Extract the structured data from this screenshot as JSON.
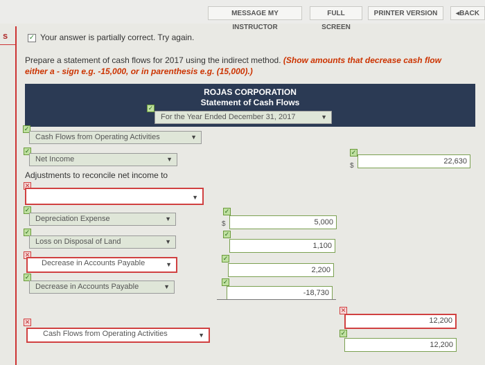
{
  "toolbar": {
    "message_instructor": "MESSAGE MY INSTRUCTOR",
    "full_screen": "FULL SCREEN",
    "printer_version": "PRINTER VERSION",
    "back": "BACK"
  },
  "side_marker": "s",
  "status": {
    "message": "Your answer is partially correct.  Try again."
  },
  "instructions": {
    "line1_plain": "Prepare a statement of cash flows for 2017 using the indirect method.",
    "line1_emphasis": "(Show amounts that decrease cash flow",
    "line2": "either a - sign e.g. -15,000, or in parenthesis e.g. (15,000).)"
  },
  "statement": {
    "company": "ROJAS CORPORATION",
    "title": "Statement of Cash Flows",
    "period": "For the Year Ended December 31, 2017"
  },
  "section_heading": "Cash Flows from Operating Activities",
  "net_income": {
    "label": "Net Income",
    "value": "22,630"
  },
  "adjustments_label": "Adjustments to reconcile net income to",
  "adjustment_rows": [
    {
      "label": "Depreciation Expense",
      "value": "5,000"
    },
    {
      "label": "Loss on Disposal of Land",
      "value": "1,100"
    },
    {
      "label": "Decrease in Accounts Payable",
      "value": "2,200"
    },
    {
      "label": "Decrease in Accounts Payable",
      "value": "-18,730"
    }
  ],
  "total_adjustments": "12,200",
  "final_row": {
    "label": "Cash Flows from Operating Activities",
    "value": "12,200"
  },
  "currency_symbol": "$",
  "colors": {
    "header_bg": "#2b3a54",
    "error_red": "#d04040",
    "correct_green": "#7aa050",
    "instruction_red": "#cc3300"
  }
}
